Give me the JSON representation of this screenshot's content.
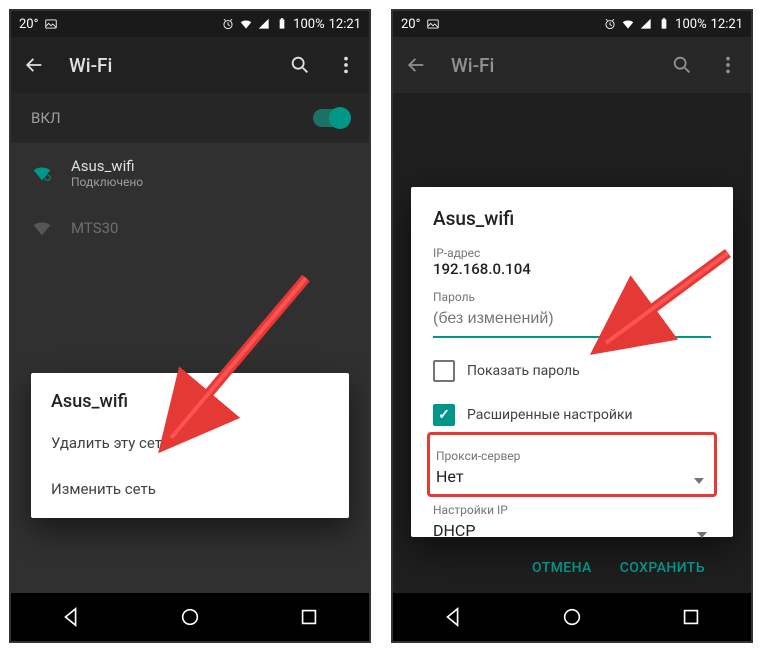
{
  "status": {
    "temperature": "20°",
    "battery": "100%",
    "time": "12:21"
  },
  "app_bar": {
    "title": "Wi-Fi"
  },
  "toggle": {
    "label": "ВКЛ"
  },
  "networks": [
    {
      "name": "Asus_wifi",
      "status": "Подключено"
    },
    {
      "name": "MTS30",
      "status": ""
    }
  ],
  "context_menu": {
    "title": "Asus_wifi",
    "items": [
      "Удалить эту сеть",
      "Изменить сеть"
    ]
  },
  "dialog": {
    "title": "Asus_wifi",
    "ip_label": "IP-адрес",
    "ip_value": "192.168.0.104",
    "password_label": "Пароль",
    "password_placeholder": "(без изменений)",
    "show_password": "Показать пароль",
    "advanced": "Расширенные настройки",
    "proxy_label": "Прокси-сервер",
    "proxy_value": "Нет",
    "ip_settings_label": "Настройки IP",
    "ip_settings_value": "DHCP",
    "cancel": "ОТМЕНА",
    "save": "СОХРАНИТЬ"
  }
}
